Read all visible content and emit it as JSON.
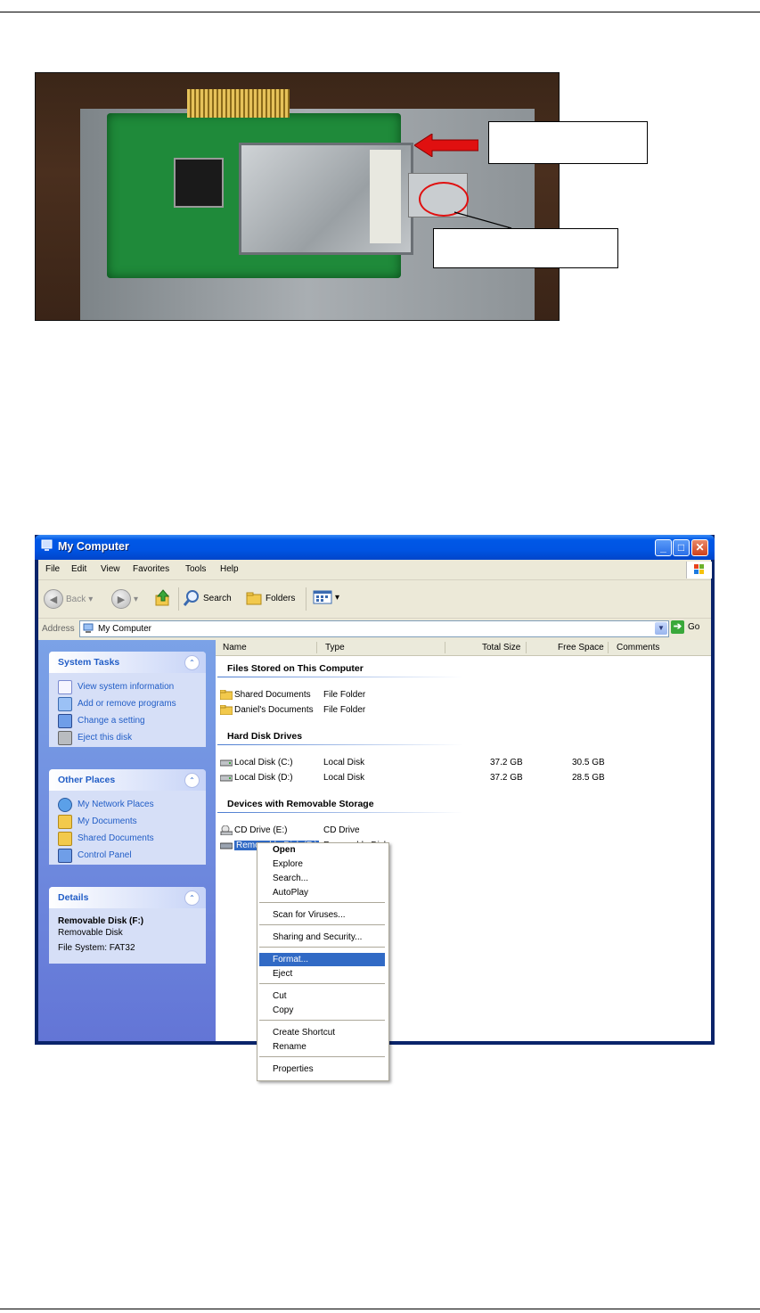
{
  "window": {
    "title": "My Computer",
    "buttons": {
      "minimize": "_",
      "maximize": "□",
      "close": "✕"
    }
  },
  "menubar": [
    "File",
    "Edit",
    "View",
    "Favorites",
    "Tools",
    "Help"
  ],
  "toolbar": {
    "back": "Back",
    "search": "Search",
    "folders": "Folders"
  },
  "address": {
    "label": "Address",
    "value": "My Computer",
    "go": "Go"
  },
  "task_pane": {
    "system_tasks": {
      "header": "System Tasks",
      "items": [
        "View system information",
        "Add or remove programs",
        "Change a setting",
        "Eject this disk"
      ]
    },
    "other_places": {
      "header": "Other Places",
      "items": [
        "My Network Places",
        "My Documents",
        "Shared Documents",
        "Control Panel"
      ]
    },
    "details": {
      "header": "Details",
      "name": "Removable Disk (F:)",
      "type": "Removable Disk",
      "fs": "File System: FAT32"
    }
  },
  "columns": [
    "Name",
    "Type",
    "Total Size",
    "Free Space",
    "Comments"
  ],
  "groups": [
    {
      "title": "Files Stored on This Computer",
      "rows": [
        {
          "name": "Shared Documents",
          "type": "File Folder",
          "total": "",
          "free": ""
        },
        {
          "name": "Daniel's Documents",
          "type": "File Folder",
          "total": "",
          "free": ""
        }
      ]
    },
    {
      "title": "Hard Disk Drives",
      "rows": [
        {
          "name": "Local Disk (C:)",
          "type": "Local Disk",
          "total": "37.2 GB",
          "free": "30.5 GB"
        },
        {
          "name": "Local Disk (D:)",
          "type": "Local Disk",
          "total": "37.2 GB",
          "free": "28.5 GB"
        }
      ]
    },
    {
      "title": "Devices with Removable Storage",
      "rows": [
        {
          "name": "CD Drive (E:)",
          "type": "CD Drive",
          "total": "",
          "free": ""
        },
        {
          "name": "Removable Disk (F:)",
          "type": "Removable Disk",
          "total": "",
          "free": ""
        }
      ]
    }
  ],
  "context_menu": [
    "Open",
    "Explore",
    "Search...",
    "AutoPlay",
    "Scan for Viruses...",
    "Sharing and Security...",
    "Format...",
    "Eject",
    "Cut",
    "Copy",
    "Create Shortcut",
    "Rename",
    "Properties"
  ],
  "colors": {
    "xp_blue": "#0054e3",
    "selection": "#316ac5",
    "task_link": "#215dc6",
    "highlight_circle": "#e01010"
  }
}
